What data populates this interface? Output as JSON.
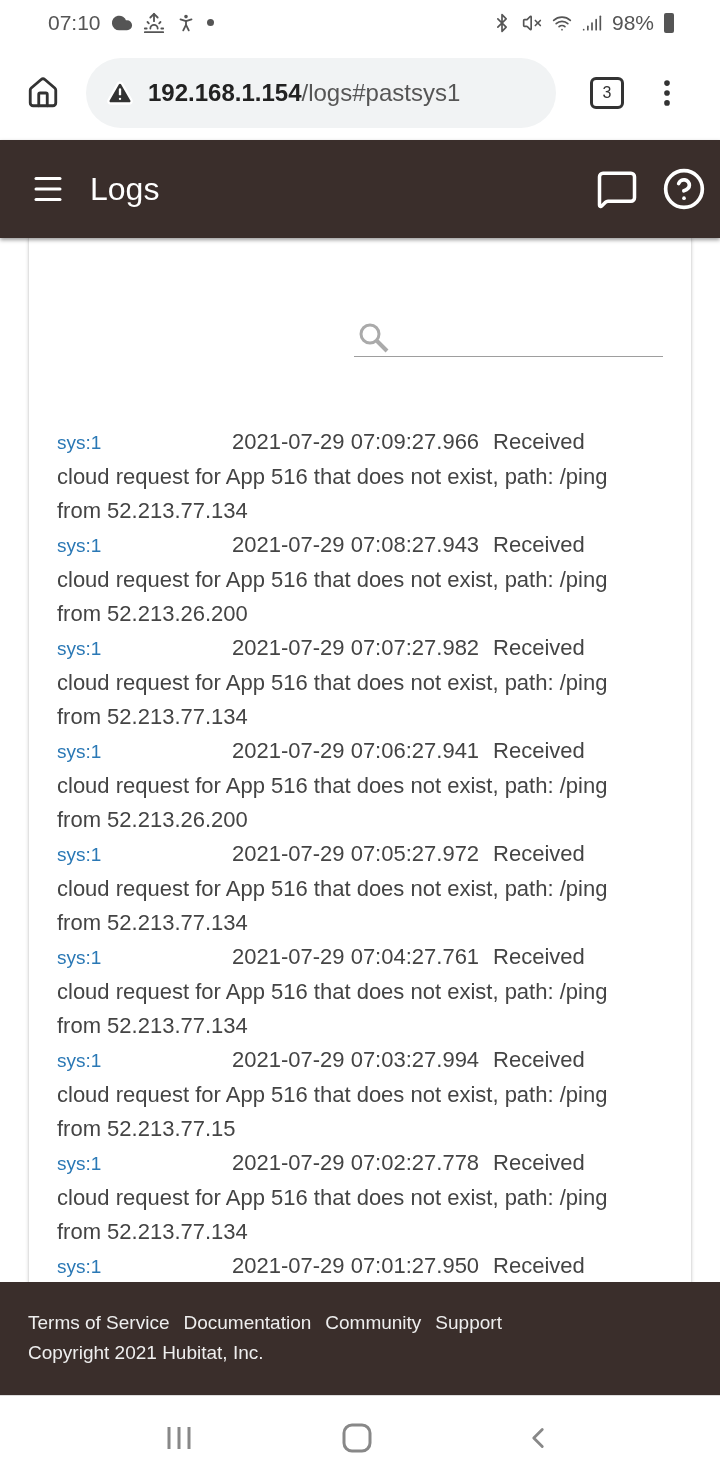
{
  "status_bar": {
    "time": "07:10",
    "battery": "98%"
  },
  "browser": {
    "url_host": "192.168.1.154",
    "url_path": "/logs#pastsys1",
    "tab_count": "3"
  },
  "app_bar": {
    "title": "Logs"
  },
  "log_entries": [
    {
      "source": "sys:1",
      "time": "2021-07-29 07:09:27.966",
      "message": "Received",
      "message_continued": "cloud request for App 516 that does not exist, path: /ping from 52.213.77.134"
    },
    {
      "source": "sys:1",
      "time": "2021-07-29 07:08:27.943",
      "message": "Received",
      "message_continued": "cloud request for App 516 that does not exist, path: /ping from 52.213.26.200"
    },
    {
      "source": "sys:1",
      "time": "2021-07-29 07:07:27.982",
      "message": "Received",
      "message_continued": "cloud request for App 516 that does not exist, path: /ping from 52.213.77.134"
    },
    {
      "source": "sys:1",
      "time": "2021-07-29 07:06:27.941",
      "message": "Received",
      "message_continued": "cloud request for App 516 that does not exist, path: /ping from 52.213.26.200"
    },
    {
      "source": "sys:1",
      "time": "2021-07-29 07:05:27.972",
      "message": "Received",
      "message_continued": "cloud request for App 516 that does not exist, path: /ping from 52.213.77.134"
    },
    {
      "source": "sys:1",
      "time": "2021-07-29 07:04:27.761",
      "message": "Received",
      "message_continued": "cloud request for App 516 that does not exist, path: /ping from 52.213.77.134"
    },
    {
      "source": "sys:1",
      "time": "2021-07-29 07:03:27.994",
      "message": "Received",
      "message_continued": "cloud request for App 516 that does not exist, path: /ping from 52.213.77.15"
    },
    {
      "source": "sys:1",
      "time": "2021-07-29 07:02:27.778",
      "message": "Received",
      "message_continued": "cloud request for App 516 that does not exist, path: /ping from 52.213.77.134"
    },
    {
      "source": "sys:1",
      "time": "2021-07-29 07:01:27.950",
      "message": "Received"
    }
  ],
  "footer": {
    "links": [
      "Terms of Service",
      "Documentation",
      "Community",
      "Support"
    ],
    "copyright": "Copyright 2021 Hubitat, Inc."
  }
}
